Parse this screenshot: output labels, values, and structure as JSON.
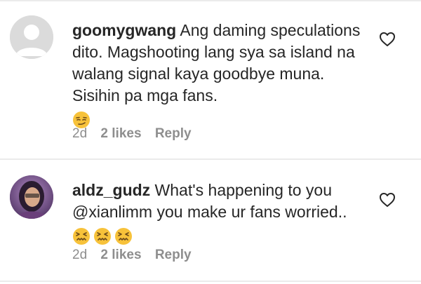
{
  "comments": [
    {
      "username": "goomygwang",
      "text": " Ang daming speculations dito. Magshooting lang sya sa island na walang signal kaya goodbye muna. Sisihin pa mga fans.",
      "emoji": [
        "smirking-face"
      ],
      "time": "2d",
      "likes": "2 likes",
      "reply": "Reply",
      "avatar": "default-avatar-icon"
    },
    {
      "username": "aldz_gudz",
      "text_before": " What's happening to you ",
      "mention": "@xianlimm",
      "text_after": "  you make ur fans worried..",
      "emoji": [
        "confounded-face",
        "confounded-face",
        "confounded-face"
      ],
      "time": "2d",
      "likes": "2 likes",
      "reply": "Reply",
      "avatar": "user-photo-avatar"
    }
  ],
  "colors": {
    "text": "#262626",
    "meta": "#8e8e8e",
    "divider": "#ebebeb",
    "emoji_yellow": "#f7c23a"
  },
  "icons": [
    "heart-outline-icon",
    "default-avatar-icon",
    "smirking-face-emoji",
    "confounded-face-emoji"
  ]
}
